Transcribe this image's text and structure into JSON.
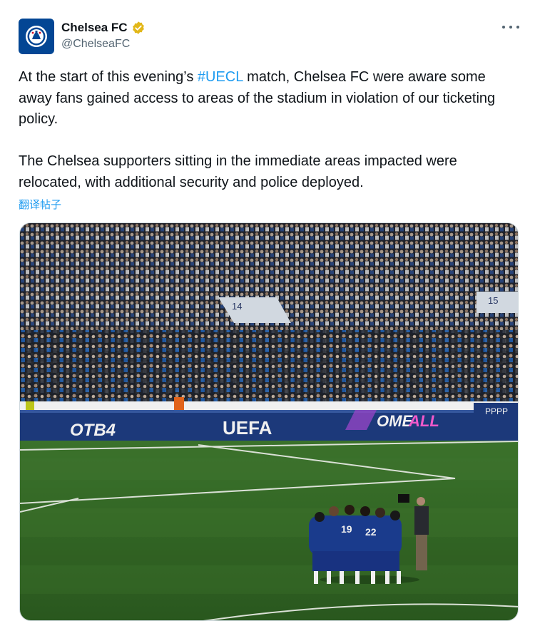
{
  "tweet": {
    "author": {
      "display_name": "Chelsea FC",
      "handle": "@ChelseaFC",
      "verified": true,
      "avatar_icon": "chelsea-crest-icon",
      "avatar_color": "#034694",
      "verified_color": "#e2b719"
    },
    "more_icon": "more-icon",
    "text": {
      "p1_before": "At the start of this evening’s ",
      "p1_hashtag": "#UECL",
      "p1_after": " match, Chelsea FC were aware some away fans gained access to areas of the stadium in violation of our ticketing policy.",
      "p2": "The Chelsea supporters sitting in the immediate areas impacted were relocated, with additional security and police deployed."
    },
    "translate_label": "翻译帖子",
    "link_color": "#1d9bf0",
    "media": {
      "description_icon": "stadium-photo",
      "board_texts": {
        "left": "OTB4",
        "center": "UEFA",
        "right_a": "OME ",
        "right_b": "ALL",
        "far_right": "PPPP"
      },
      "stand_numbers": {
        "left": "14",
        "right": "15"
      },
      "shirt_numbers": [
        "19",
        "22"
      ]
    }
  }
}
